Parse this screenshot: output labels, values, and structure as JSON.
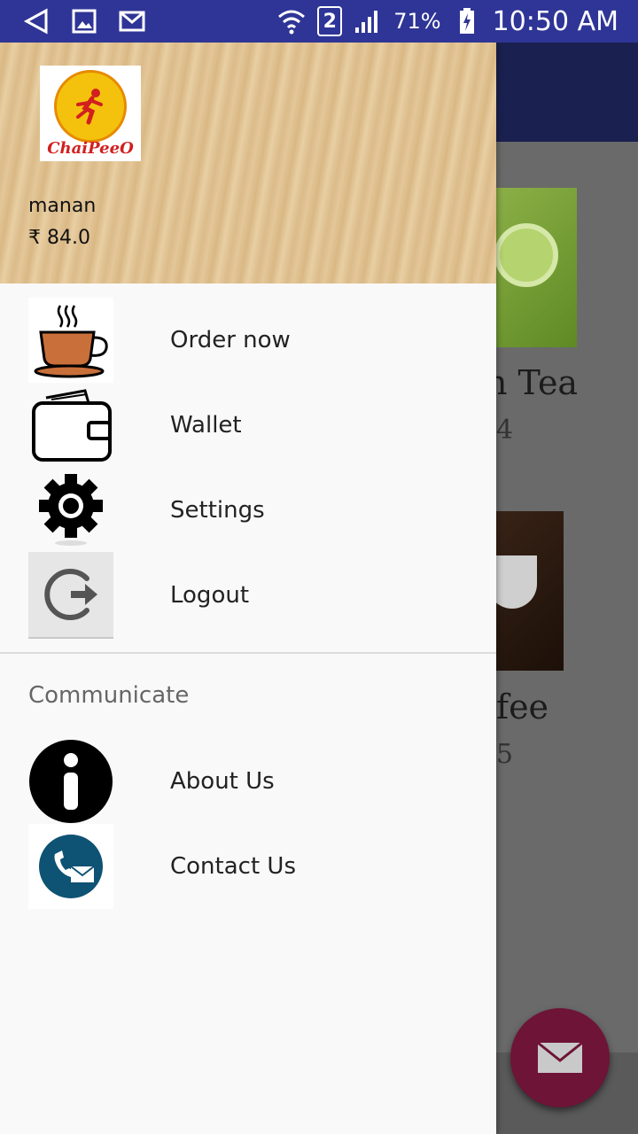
{
  "status_bar": {
    "battery_pct": "71%",
    "sim": "2",
    "time": "10:50 AM"
  },
  "background": {
    "item1_name": "n Tea",
    "item1_price": "4",
    "item2_name": "fee",
    "item2_price": "5"
  },
  "drawer": {
    "logo_text": "ChaiPeeO",
    "user_name": "manan",
    "balance": "₹ 84.0",
    "menu": [
      {
        "label": "Order now",
        "icon": "tea-cup-icon"
      },
      {
        "label": "Wallet",
        "icon": "wallet-icon"
      },
      {
        "label": "Settings",
        "icon": "gear-icon"
      },
      {
        "label": "Logout",
        "icon": "logout-icon"
      }
    ],
    "section_title": "Communicate",
    "communicate": [
      {
        "label": "About Us",
        "icon": "info-icon"
      },
      {
        "label": "Contact Us",
        "icon": "contact-icon"
      }
    ]
  }
}
